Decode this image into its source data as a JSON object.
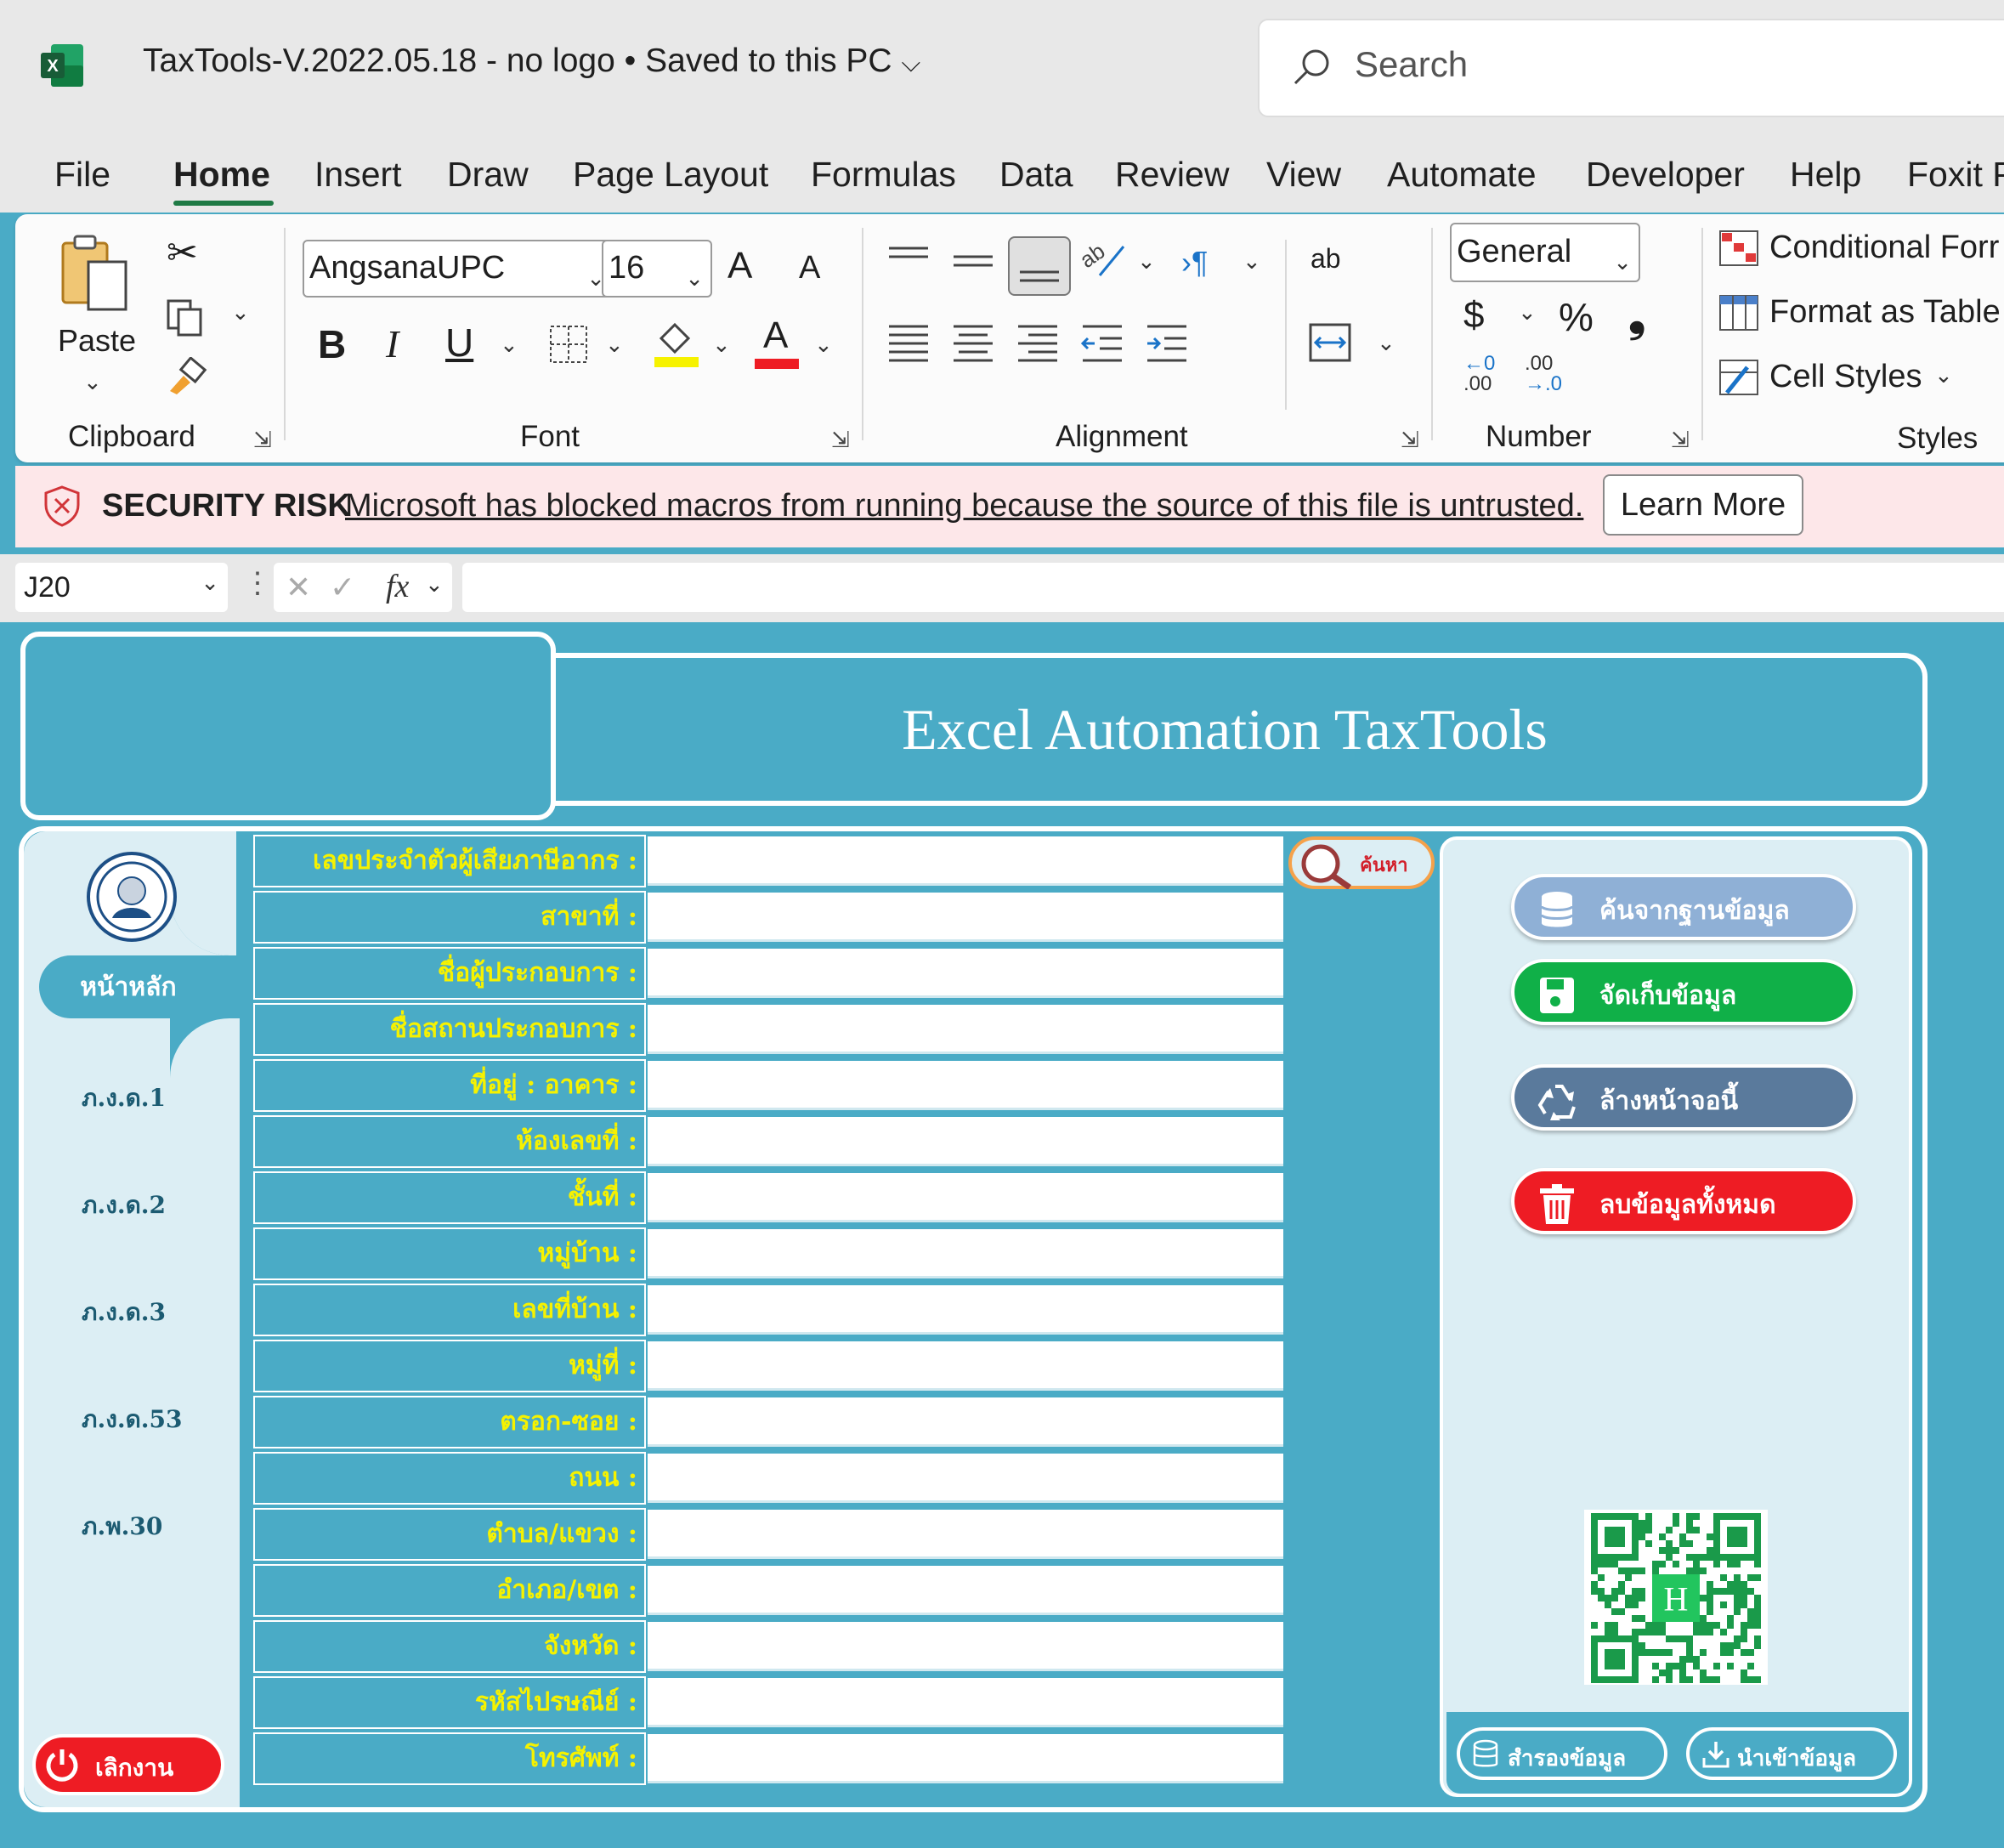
{
  "window": {
    "file_title": "TaxTools-V.2022.05.18 - no logo • Saved to this PC",
    "search_placeholder": "Search"
  },
  "menu": [
    "File",
    "Home",
    "Insert",
    "Draw",
    "Page Layout",
    "Formulas",
    "Data",
    "Review",
    "View",
    "Automate",
    "Developer",
    "Help",
    "Foxit P"
  ],
  "ribbon": {
    "clipboard": {
      "paste_label": "Paste",
      "group_label": "Clipboard"
    },
    "font": {
      "font_name": "AngsanaUPC",
      "font_size": "16",
      "grow_label": "A",
      "shrink_label": "A",
      "bold": "B",
      "italic": "I",
      "underline": "U",
      "color_glyph": "A",
      "group_label": "Font"
    },
    "alignment": {
      "group_label": "Alignment",
      "wrap_glyph": "ab"
    },
    "number": {
      "format": "General",
      "currency": "$",
      "percent": "%",
      "comma": "❟",
      "inc_decimal_top": "←0",
      "inc_decimal_bottom": ".00",
      "dec_decimal_top": ".00",
      "dec_decimal_bottom": "→.0",
      "group_label": "Number"
    },
    "styles": {
      "conditional": "Conditional Forr",
      "format_table": "Format as Table",
      "cell_styles": "Cell Styles",
      "group_label": "Styles"
    }
  },
  "security": {
    "title": "SECURITY RISK",
    "message": "Microsoft has blocked macros from running because the source of this file is untrusted.",
    "button": "Learn More"
  },
  "formula_bar": {
    "name_box": "J20",
    "fx": "fx",
    "value": ""
  },
  "sheet": {
    "title": "Excel Automation TaxTools",
    "nav": {
      "home": "หน้าหลัก",
      "items": [
        "ภ.ง.ด.1",
        "ภ.ง.ด.2",
        "ภ.ง.ด.3",
        "ภ.ง.ด.53",
        "ภ.พ.30"
      ],
      "quit": "เลิกงาน"
    },
    "form_fields": [
      {
        "label": "เลขประจำตัวผู้เสียภาษีอากร :",
        "value": ""
      },
      {
        "label": "สาขาที่ :",
        "value": ""
      },
      {
        "label": "ชื่อผู้ประกอบการ :",
        "value": ""
      },
      {
        "label": "ชื่อสถานประกอบการ :",
        "value": ""
      },
      {
        "label": "ที่อยู่ : อาคาร :",
        "value": ""
      },
      {
        "label": "ห้องเลขที่ :",
        "value": ""
      },
      {
        "label": "ชั้นที่ :",
        "value": ""
      },
      {
        "label": "หมู่บ้าน :",
        "value": ""
      },
      {
        "label": "เลขที่บ้าน :",
        "value": ""
      },
      {
        "label": "หมู่ที่ :",
        "value": ""
      },
      {
        "label": "ตรอก-ซอย :",
        "value": ""
      },
      {
        "label": "ถนน :",
        "value": ""
      },
      {
        "label": "ตำบล/แขวง :",
        "value": ""
      },
      {
        "label": "อำเภอ/เขต :",
        "value": ""
      },
      {
        "label": "จังหวัด :",
        "value": ""
      },
      {
        "label": "รหัสไปรษณีย์ :",
        "value": ""
      },
      {
        "label": "โทรศัพท์ :",
        "value": ""
      }
    ],
    "search_button": "ค้นหา",
    "actions": [
      {
        "label": "ค้นจากฐานข้อมูล",
        "color": "#8fb0d6",
        "icon": "database-icon"
      },
      {
        "label": "จัดเก็บข้อมูล",
        "color": "#10b048",
        "icon": "floppy-disk-icon"
      },
      {
        "label": "ล้างหน้าจอนี้",
        "color": "#5a7a9c",
        "icon": "recycle-icon"
      },
      {
        "label": "ลบข้อมูลทั้งหมด",
        "color": "#ee1c24",
        "icon": "trash-icon"
      }
    ],
    "backup_button": "สำรองข้อมูล",
    "import_button": "นำเข้าข้อมูล",
    "qr_center": "H"
  },
  "colors": {
    "sheet_bg": "#4aabc6",
    "panel_bg": "#dceef4",
    "label_text": "#f6f200",
    "nav_text": "#1c5b72",
    "excel_green": "#1f7a45"
  }
}
